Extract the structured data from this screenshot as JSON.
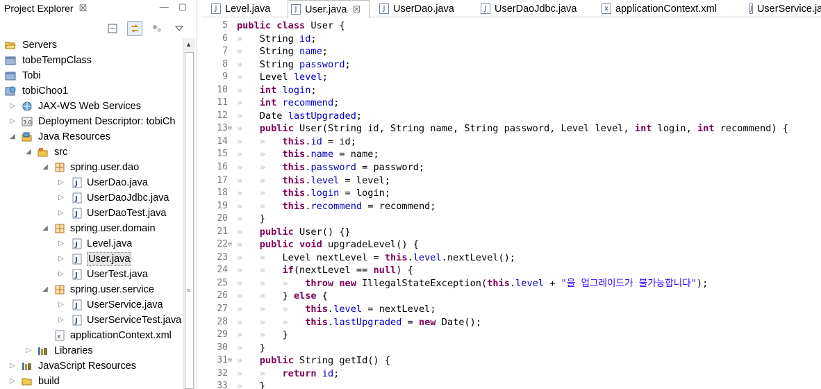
{
  "explorer": {
    "title": "Project Explorer",
    "close_glyph": "☒",
    "min_glyph": "—",
    "max_glyph": "▢",
    "items": [
      {
        "label": "Servers",
        "icon": "folder-open-icon"
      },
      {
        "label": "tobeTempClass",
        "icon": "project-icon"
      },
      {
        "label": "Tobi",
        "icon": "project-icon"
      },
      {
        "label": "tobiChoo1",
        "icon": "web-project-icon"
      },
      {
        "label": "JAX-WS Web Services",
        "icon": "webservice-icon"
      },
      {
        "label": "Deployment Descriptor: tobiCh",
        "icon": "descriptor-icon"
      },
      {
        "label": "Java Resources",
        "icon": "java-resources-icon"
      },
      {
        "label": "src",
        "icon": "source-folder-icon"
      },
      {
        "label": "spring.user.dao",
        "icon": "package-icon"
      },
      {
        "label": "UserDao.java",
        "icon": "java-file-icon"
      },
      {
        "label": "UserDaoJdbc.java",
        "icon": "java-file-icon"
      },
      {
        "label": "UserDaoTest.java",
        "icon": "java-file-icon"
      },
      {
        "label": "spring.user.domain",
        "icon": "package-icon"
      },
      {
        "label": "Level.java",
        "icon": "java-file-icon"
      },
      {
        "label": "User.java",
        "icon": "java-file-icon"
      },
      {
        "label": "UserTest.java",
        "icon": "java-file-icon"
      },
      {
        "label": "spring.user.service",
        "icon": "package-icon"
      },
      {
        "label": "UserService.java",
        "icon": "java-file-icon"
      },
      {
        "label": "UserServiceTest.java",
        "icon": "java-file-icon"
      },
      {
        "label": "applicationContext.xml",
        "icon": "xml-file-icon"
      },
      {
        "label": "Libraries",
        "icon": "library-icon"
      },
      {
        "label": "JavaScript Resources",
        "icon": "library-icon"
      },
      {
        "label": "build",
        "icon": "folder-icon"
      }
    ]
  },
  "editor": {
    "tabs": [
      {
        "label": "Level.java",
        "icon": "java-file-icon"
      },
      {
        "label": "User.java",
        "icon": "java-file-icon",
        "close": "☒"
      },
      {
        "label": "UserDao.java",
        "icon": "java-file-icon"
      },
      {
        "label": "UserDaoJdbc.java",
        "icon": "java-file-icon"
      },
      {
        "label": "applicationContext.xml",
        "icon": "xml-file-icon"
      },
      {
        "label": "UserService.ja",
        "icon": "java-file-icon"
      }
    ],
    "lines": [
      {
        "n": "5",
        "code": "public class User {"
      },
      {
        "n": "6",
        "code": "    String id;"
      },
      {
        "n": "7",
        "code": "    String name;"
      },
      {
        "n": "8",
        "code": "    String password;"
      },
      {
        "n": "9",
        "code": "    Level level;"
      },
      {
        "n": "10",
        "code": "    int login;"
      },
      {
        "n": "11",
        "code": "    int recommend;"
      },
      {
        "n": "12",
        "code": "    Date lastUpgraded;"
      },
      {
        "n": "13",
        "code": "    public User(String id, String name, String password, Level level, int login, int recommend) {",
        "fold": "⊖"
      },
      {
        "n": "14",
        "code": "        this.id = id;"
      },
      {
        "n": "15",
        "code": "        this.name = name;"
      },
      {
        "n": "16",
        "code": "        this.password = password;"
      },
      {
        "n": "17",
        "code": "        this.level = level;"
      },
      {
        "n": "18",
        "code": "        this.login = login;"
      },
      {
        "n": "19",
        "code": "        this.recommend = recommend;"
      },
      {
        "n": "20",
        "code": "    }"
      },
      {
        "n": "21",
        "code": "    public User() {}"
      },
      {
        "n": "22",
        "code": "    public void upgradeLevel() {",
        "fold": "⊖"
      },
      {
        "n": "23",
        "code": "        Level nextLevel = this.level.nextLevel();"
      },
      {
        "n": "24",
        "code": "        if(nextLevel == null) {"
      },
      {
        "n": "25",
        "code": "            throw new IllegalStateException(this.level + \"을 업그레이드가 불가능합니다\");"
      },
      {
        "n": "26",
        "code": "        } else {"
      },
      {
        "n": "27",
        "code": "            this.level = nextLevel;"
      },
      {
        "n": "28",
        "code": "            this.lastUpgraded = new Date();"
      },
      {
        "n": "29",
        "code": "        }"
      },
      {
        "n": "30",
        "code": "    }"
      },
      {
        "n": "31",
        "code": "    public String getId() {",
        "fold": "⊖"
      },
      {
        "n": "32",
        "code": "        return id;"
      },
      {
        "n": "33",
        "code": "    }"
      }
    ]
  },
  "colors": {
    "keyword": "#7f0055",
    "field": "#0000c0",
    "string": "#2a00ff",
    "line_number": "#787878"
  }
}
